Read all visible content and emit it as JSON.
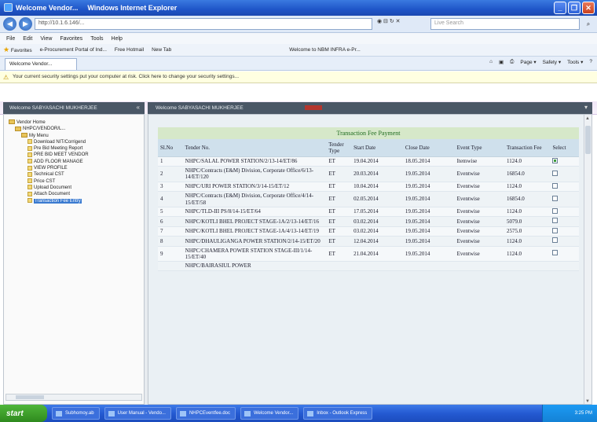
{
  "window": {
    "title": "Welcome Vendor...",
    "app_name": "Windows Internet Explorer",
    "buttons": [
      "_",
      "❐",
      "✕"
    ]
  },
  "address_bar": {
    "url": "http://10.1.6.146/...",
    "search_placeholder": "Live Search",
    "tools": "◉ ⊟ ↻ ✕"
  },
  "menu": [
    "File",
    "Edit",
    "View",
    "Favorites",
    "Tools",
    "Help"
  ],
  "favorites_bar": {
    "label": "Favorites",
    "items": [
      "e-Procurement Portal of Ind...",
      "Free Hotmail",
      "New Tab",
      "Welcome to NBM INFRA e-Pr..."
    ]
  },
  "tab": {
    "label": "Welcome Vendor...",
    "commands": [
      "Page ▾",
      "Safety ▾",
      "Tools ▾"
    ]
  },
  "infobar": {
    "text": "Your current security settings put your computer at risk. Click here to change your security settings..."
  },
  "left_panel": {
    "header": "Welcome SABYASACHI MUKHERJEE",
    "tree": [
      {
        "label": "Vendor Home",
        "type": "folder",
        "depth": 0
      },
      {
        "label": "NHPC/VENDOR/L...",
        "type": "folder",
        "depth": 1
      },
      {
        "label": "My Menu",
        "type": "folder",
        "depth": 2
      },
      {
        "label": "Download NIT/Corrigend",
        "type": "leaf",
        "depth": 3
      },
      {
        "label": "Pre Bid Meeting Report",
        "type": "leaf",
        "depth": 3
      },
      {
        "label": "PRE BID MEET VENDOR",
        "type": "leaf",
        "depth": 3
      },
      {
        "label": "ADD FLOOR MANAGE",
        "type": "leaf",
        "depth": 3
      },
      {
        "label": "VIEW PROFILE",
        "type": "leaf",
        "depth": 3
      },
      {
        "label": "Technical CST",
        "type": "leaf",
        "depth": 3
      },
      {
        "label": "Price CST",
        "type": "leaf",
        "depth": 3
      },
      {
        "label": "Upload Document",
        "type": "leaf",
        "depth": 3
      },
      {
        "label": "Attach Document",
        "type": "leaf",
        "depth": 3
      },
      {
        "label": "Transaction Fee Entry",
        "type": "leaf",
        "depth": 3,
        "selected": true
      }
    ]
  },
  "main_panel": {
    "header": "Welcome SABYASACHI MUKHERJEE",
    "table": {
      "caption": "Transaction Fee Payment",
      "columns": [
        "Sl.No",
        "Tender No.",
        "Tender Type",
        "Start Date",
        "Close Date",
        "Event Type",
        "Transaction Fee",
        "Select"
      ],
      "rows": [
        {
          "sl": "1",
          "tender": "NHPC/SALAL POWER STATION/2/13-14/ET/86",
          "type": "ET",
          "start": "19.04.2014",
          "close": "18.05.2014",
          "event": "Itemwise",
          "fee": "1124.0",
          "selected": true
        },
        {
          "sl": "2",
          "tender": "NHPC/Contracts (E&M) Division, Corporate Office/6/13-14/ET/120",
          "type": "ET",
          "start": "20.03.2014",
          "close": "19.05.2014",
          "event": "Eventwise",
          "fee": "16854.0",
          "selected": false
        },
        {
          "sl": "3",
          "tender": "NHPC/URI POWER STATION/3/14-15/ET/12",
          "type": "ET",
          "start": "10.04.2014",
          "close": "19.05.2014",
          "event": "Eventwise",
          "fee": "1124.0",
          "selected": false
        },
        {
          "sl": "4",
          "tender": "NHPC/Contracts (E&M) Division, Corporate Office/4/14-15/ET/58",
          "type": "ET",
          "start": "02.05.2014",
          "close": "19.05.2014",
          "event": "Eventwise",
          "fee": "16854.0",
          "selected": false
        },
        {
          "sl": "5",
          "tender": "NHPC/TLD-III PS/8/14-15/ET/64",
          "type": "ET",
          "start": "17.05.2014",
          "close": "19.05.2014",
          "event": "Eventwise",
          "fee": "1124.0",
          "selected": false
        },
        {
          "sl": "6",
          "tender": "NHPC/KOTLI BHEL PROJECT STAGE-1A/2/13-14/ET/16",
          "type": "ET",
          "start": "03.02.2014",
          "close": "19.05.2014",
          "event": "Eventwise",
          "fee": "5079.0",
          "selected": false
        },
        {
          "sl": "7",
          "tender": "NHPC/KOTLI BHEL PROJECT STAGE-1A/4/13-14/ET/19",
          "type": "ET",
          "start": "03.02.2014",
          "close": "19.05.2014",
          "event": "Eventwise",
          "fee": "2575.0",
          "selected": false
        },
        {
          "sl": "8",
          "tender": "NHPC/DHAULIGANGA POWER STATION/2/14-15/ET/20",
          "type": "ET",
          "start": "12.04.2014",
          "close": "19.05.2014",
          "event": "Eventwise",
          "fee": "1124.0",
          "selected": false
        },
        {
          "sl": "9",
          "tender": "NHPC/CHAMERA POWER STATION STAGE-III/1/14-15/ET/40",
          "type": "ET",
          "start": "21.04.2014",
          "close": "19.05.2014",
          "event": "Eventwise",
          "fee": "1124.0",
          "selected": false
        },
        {
          "sl": "",
          "tender": "NHPC/BAIRASIUL POWER",
          "type": "",
          "start": "",
          "close": "",
          "event": "",
          "fee": "",
          "selected": false
        }
      ]
    }
  },
  "taskbar": {
    "start": "start",
    "items": [
      "Subhomoy.ab",
      "User Manual - Vendo...",
      "NHPCEventfee.doc",
      "Welcome Vendor...",
      "Inbox - Outlook Express"
    ],
    "clock": "3:25 PM"
  }
}
